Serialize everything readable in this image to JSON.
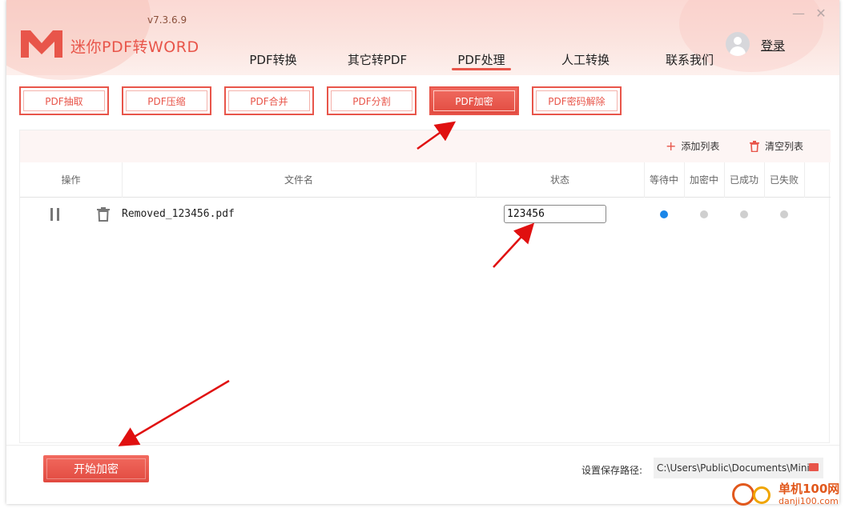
{
  "app": {
    "name": "迷你PDF转WORD",
    "version": "v7.3.6.9",
    "login": "登录"
  },
  "nav": [
    {
      "label": "PDF转换"
    },
    {
      "label": "其它转PDF"
    },
    {
      "label": "PDF处理",
      "active": true
    },
    {
      "label": "人工转换"
    },
    {
      "label": "联系我们"
    }
  ],
  "tools": [
    {
      "label": "PDF抽取"
    },
    {
      "label": "PDF压缩"
    },
    {
      "label": "PDF合并"
    },
    {
      "label": "PDF分割"
    },
    {
      "label": "PDF加密",
      "active": true
    },
    {
      "label": "PDF密码解除"
    }
  ],
  "toolbar": {
    "add_list": "添加列表",
    "clear_list": "清空列表"
  },
  "table": {
    "headers": {
      "actions": "操作",
      "filename": "文件名",
      "status": "状态",
      "waiting": "等待中",
      "encrypting": "加密中",
      "succeeded": "已成功",
      "failed": "已失败"
    },
    "rows": [
      {
        "filename": "Removed_123456.pdf",
        "password": "123456",
        "state": "waiting"
      }
    ]
  },
  "footer": {
    "start_button": "开始加密",
    "save_path_label": "设置保存路径:",
    "save_path": "C:\\Users\\Public\\Documents\\Mini"
  },
  "watermark": {
    "top": "单机100网",
    "bottom": "danji100.com"
  },
  "colors": {
    "accent": "#e8554a",
    "status_active": "#1a86e8",
    "status_inactive": "#cfcfcf"
  }
}
